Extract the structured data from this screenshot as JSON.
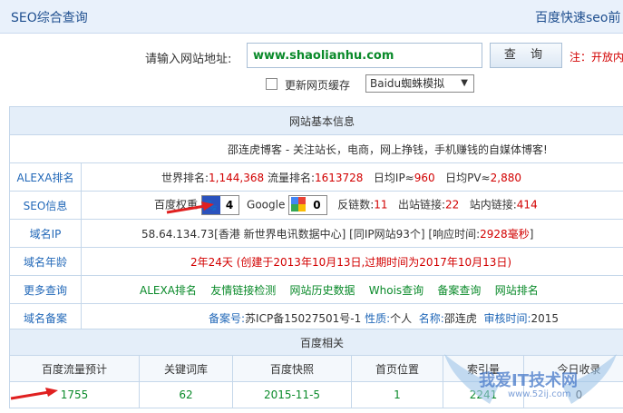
{
  "header": {
    "title": "SEO综合查询",
    "right_link": "百度快速seo前"
  },
  "query": {
    "label": "请输入网站地址:",
    "url_value": "www.shaolianhu.com",
    "submit": "查 询",
    "note": "注：开放内"
  },
  "options": {
    "refresh_cache": "更新网页缓存",
    "spider_select": "Baidu蜘蛛模拟"
  },
  "basic": {
    "header": "网站基本信息",
    "site_desc": "邵连虎博客 - 关注站长，电商，网上挣钱，手机赚钱的自媒体博客!",
    "alexa": {
      "label": "ALEXA排名",
      "world_label": "世界排名:",
      "world": "1,144,368",
      "traffic_label": "流量排名:",
      "traffic": "1613728",
      "ip_label": "日均IP≈",
      "ip": "960",
      "pv_label": "日均PV≈",
      "pv": "2,880"
    },
    "seo": {
      "label": "SEO信息",
      "baidu_weight_label": "百度权重",
      "baidu_weight": "4",
      "google_label": "Google",
      "google_pr": "0",
      "backlinks_label": "反链数:",
      "backlinks": "11",
      "outlinks_label": "出站链接:",
      "outlinks": "22",
      "inlinks_label": "站内链接:",
      "inlinks": "414"
    },
    "ip": {
      "label": "域名IP",
      "address": "58.64.134.73[香港 新世界电讯数据中心]",
      "same_ip": "[同IP网站93个]",
      "response_label": "[响应时间:",
      "response": "2928毫秒",
      "response_end": "]"
    },
    "age": {
      "label": "域名年龄",
      "text": "2年24天 (创建于2013年10月13日,过期时间为2017年10月13日)"
    },
    "more": {
      "label": "更多查询",
      "links": [
        "ALEXA排名",
        "友情链接检测",
        "网站历史数据",
        "Whois查询",
        "备案查询",
        "网站排名"
      ]
    },
    "icp": {
      "label": "域名备案",
      "icp_label": "备案号:",
      "icp": "苏ICP备15027501号-1",
      "nature_label": "性质:",
      "nature": "个人",
      "name_label": "名称:",
      "name": "邵连虎",
      "audit_label": "审核时间:",
      "audit": "2015"
    }
  },
  "baidu": {
    "header": "百度相关",
    "columns": [
      "百度流量预计",
      "关键词库",
      "百度快照",
      "首页位置",
      "索引量",
      "今日收录"
    ],
    "values": [
      "1755",
      "62",
      "2015-11-5",
      "1",
      "2241",
      "0"
    ]
  },
  "watermark": {
    "text": "我爱IT技术网",
    "sub": "www.52ij.com"
  },
  "colors": {
    "accent_red": "#d20000",
    "link_green": "#0a8a2a",
    "link_blue": "#2268b8",
    "header_bg": "#e4eef9"
  }
}
